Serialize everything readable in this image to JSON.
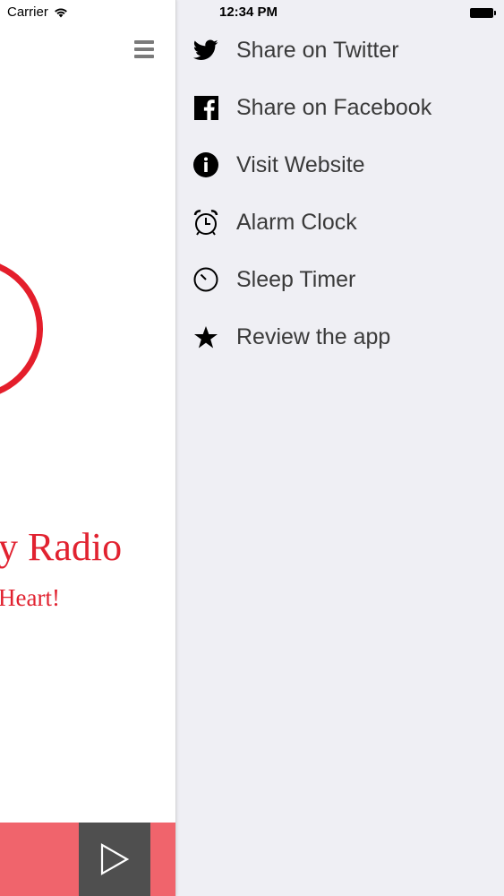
{
  "status_bar": {
    "carrier": "Carrier",
    "time": "12:34 PM"
  },
  "main": {
    "title_fragment": "y Radio",
    "subtitle_fragment": "Heart!"
  },
  "menu": {
    "items": [
      {
        "label": "Share on Twitter",
        "icon": "twitter-icon"
      },
      {
        "label": "Share on Facebook",
        "icon": "facebook-icon"
      },
      {
        "label": "Visit Website",
        "icon": "info-icon"
      },
      {
        "label": "Alarm Clock",
        "icon": "alarm-clock-icon"
      },
      {
        "label": "Sleep Timer",
        "icon": "timer-icon"
      },
      {
        "label": "Review the app",
        "icon": "star-icon"
      }
    ]
  },
  "colors": {
    "brand_red": "#e12230",
    "player_bar": "#f0646c",
    "play_button": "#4f4f4f",
    "menu_background": "#efeff4"
  }
}
